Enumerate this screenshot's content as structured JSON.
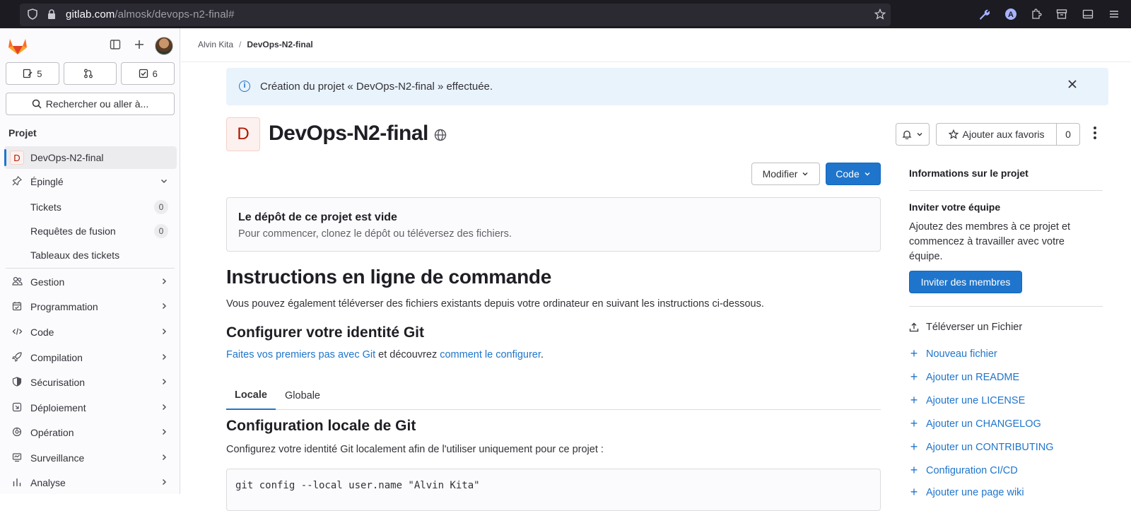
{
  "browser": {
    "url_host": "gitlab.com",
    "url_path": "/almosk/devops-n2-final#"
  },
  "sidebar": {
    "counters": [
      {
        "icon": "issues-icon",
        "count": "5"
      },
      {
        "icon": "merge-request-icon",
        "count": ""
      },
      {
        "icon": "todo-icon",
        "count": "6"
      }
    ],
    "search_label": "Rechercher ou aller à...",
    "section_title": "Projet",
    "project_item": {
      "badge": "D",
      "label": "DevOps-N2-final"
    },
    "pinned": {
      "label": "Épinglé"
    },
    "pinned_items": [
      {
        "label": "Tickets",
        "count": "0"
      },
      {
        "label": "Requêtes de fusion",
        "count": "0"
      },
      {
        "label": "Tableaux des tickets"
      }
    ],
    "nav": [
      {
        "label": "Gestion",
        "icon": "users-icon"
      },
      {
        "label": "Programmation",
        "icon": "calendar-icon"
      },
      {
        "label": "Code",
        "icon": "code-icon"
      },
      {
        "label": "Compilation",
        "icon": "rocket-icon"
      },
      {
        "label": "Sécurisation",
        "icon": "shield-icon"
      },
      {
        "label": "Déploiement",
        "icon": "deploy-icon"
      },
      {
        "label": "Opération",
        "icon": "cloud-gear-icon"
      },
      {
        "label": "Surveillance",
        "icon": "monitor-icon"
      },
      {
        "label": "Analyse",
        "icon": "chart-icon"
      }
    ]
  },
  "breadcrumb": {
    "parent": "Alvin Kita",
    "current": "DevOps-N2-final"
  },
  "alert": {
    "text": "Création du projet « DevOps-N2-final » effectuée."
  },
  "project": {
    "avatar_letter": "D",
    "title": "DevOps-N2-final",
    "star_label": "Ajouter aux favoris",
    "star_count": "0",
    "modify_label": "Modifier",
    "code_label": "Code"
  },
  "empty_repo": {
    "title": "Le dépôt de ce projet est vide",
    "description": "Pour commencer, clonez le dépôt ou téléversez des fichiers."
  },
  "instructions": {
    "title": "Instructions en ligne de commande",
    "intro": "Vous pouvez également téléverser des fichiers existants depuis votre ordinateur en suivant les instructions ci-dessous.",
    "git_identity_title": "Configurer votre identité Git",
    "link1": "Faites vos premiers pas avec Git",
    "middle": " et découvrez ",
    "link2": "comment le configurer",
    "end": ".",
    "tabs": [
      "Locale",
      "Globale"
    ],
    "local_title": "Configuration locale de Git",
    "local_desc": "Configurez votre identité Git localement afin de l'utiliser uniquement pour ce projet :",
    "code": "git config --local user.name \"Alvin Kita\""
  },
  "right_panel": {
    "title": "Informations sur le projet",
    "invite_title": "Inviter votre équipe",
    "invite_text": "Ajoutez des membres à ce projet et commencez à travailler avec votre équipe.",
    "invite_button": "Inviter des membres",
    "upload": "Téléverser un Fichier",
    "actions": [
      "Nouveau fichier",
      "Ajouter un README",
      "Ajouter une LICENSE",
      "Ajouter un CHANGELOG",
      "Ajouter un CONTRIBUTING",
      "Configuration CI/CD",
      "Ajouter une page wiki"
    ]
  }
}
